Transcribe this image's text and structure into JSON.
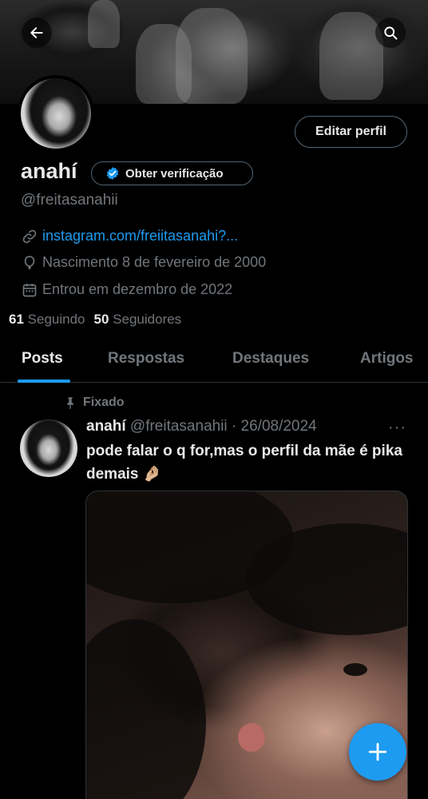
{
  "header": {
    "back_icon": "arrow-left-icon",
    "search_icon": "search-icon"
  },
  "profile": {
    "name": "anahí",
    "handle": "@freitasanahii",
    "edit_button": "Editar perfil",
    "verify_button": "Obter verificação",
    "link": "instagram.com/freiitasanahi?...",
    "birth": "Nascimento 8 de fevereiro de 2000",
    "joined": "Entrou em dezembro de 2022",
    "following_count": "61",
    "following_label": "Seguindo",
    "followers_count": "50",
    "followers_label": "Seguidores"
  },
  "tabs": [
    {
      "label": "Posts"
    },
    {
      "label": "Respostas"
    },
    {
      "label": "Destaques"
    },
    {
      "label": "Artigos"
    }
  ],
  "post": {
    "pinned_label": "Fixado",
    "author_name": "anahí",
    "author_meta": "@freitasanahii · 26/08/2024",
    "more": "···",
    "text": "pode falar o q for,mas o perfil da mãe é pika demais 🤌🏼"
  },
  "colors": {
    "accent": "#1d9bf0",
    "background": "#000000",
    "muted": "#71767b"
  }
}
